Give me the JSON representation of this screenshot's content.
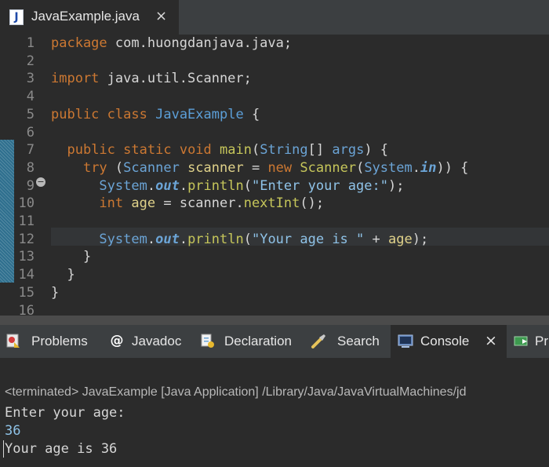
{
  "editor_tab": {
    "label": "JavaExample.java",
    "icon": "java-file-icon",
    "close": "×"
  },
  "code": {
    "line_numbers": [
      "1",
      "2",
      "3",
      "4",
      "5",
      "6",
      "7",
      "8",
      "9",
      "10",
      "11",
      "12",
      "13",
      "14",
      "15",
      "16"
    ],
    "lines": [
      [
        {
          "t": "package",
          "c": "kw"
        },
        {
          "t": " com.huongdanjava.java;",
          "c": "pl"
        }
      ],
      [],
      [
        {
          "t": "import",
          "c": "kw"
        },
        {
          "t": " java.util.Scanner;",
          "c": "pl"
        }
      ],
      [],
      [
        {
          "t": "public",
          "c": "kw"
        },
        {
          "t": " ",
          "c": "pl"
        },
        {
          "t": "class",
          "c": "kw"
        },
        {
          "t": " ",
          "c": "pl"
        },
        {
          "t": "JavaExample",
          "c": "cls"
        },
        {
          "t": " {",
          "c": "pl"
        }
      ],
      [],
      [
        {
          "t": "  ",
          "c": "pl"
        },
        {
          "t": "public",
          "c": "kw"
        },
        {
          "t": " ",
          "c": "pl"
        },
        {
          "t": "static",
          "c": "kw"
        },
        {
          "t": " ",
          "c": "pl"
        },
        {
          "t": "void",
          "c": "kw"
        },
        {
          "t": " ",
          "c": "pl"
        },
        {
          "t": "main",
          "c": "fn"
        },
        {
          "t": "(",
          "c": "pl"
        },
        {
          "t": "String",
          "c": "ty"
        },
        {
          "t": "[] ",
          "c": "pl"
        },
        {
          "t": "args",
          "c": "ty"
        },
        {
          "t": ") {",
          "c": "pl"
        }
      ],
      [
        {
          "t": "    ",
          "c": "pl"
        },
        {
          "t": "try",
          "c": "kw"
        },
        {
          "t": " (",
          "c": "pl"
        },
        {
          "t": "Scanner",
          "c": "ty"
        },
        {
          "t": " ",
          "c": "pl"
        },
        {
          "t": "scanner",
          "c": "var"
        },
        {
          "t": " = ",
          "c": "pl"
        },
        {
          "t": "new",
          "c": "kw"
        },
        {
          "t": " ",
          "c": "pl"
        },
        {
          "t": "Scanner",
          "c": "fn"
        },
        {
          "t": "(",
          "c": "pl"
        },
        {
          "t": "System",
          "c": "ty"
        },
        {
          "t": ".",
          "c": "pl"
        },
        {
          "t": "in",
          "c": "sy"
        },
        {
          "t": ")) {",
          "c": "pl"
        }
      ],
      [
        {
          "t": "      ",
          "c": "pl"
        },
        {
          "t": "System",
          "c": "ty"
        },
        {
          "t": ".",
          "c": "pl"
        },
        {
          "t": "out",
          "c": "sy"
        },
        {
          "t": ".",
          "c": "pl"
        },
        {
          "t": "println",
          "c": "fn"
        },
        {
          "t": "(",
          "c": "pl"
        },
        {
          "t": "\"Enter your age:\"",
          "c": "str"
        },
        {
          "t": ");",
          "c": "pl"
        }
      ],
      [
        {
          "t": "      ",
          "c": "pl"
        },
        {
          "t": "int",
          "c": "kw"
        },
        {
          "t": " ",
          "c": "pl"
        },
        {
          "t": "age",
          "c": "var"
        },
        {
          "t": " = scanner.",
          "c": "pl"
        },
        {
          "t": "nextInt",
          "c": "fn"
        },
        {
          "t": "();",
          "c": "pl"
        }
      ],
      [],
      [
        {
          "t": "      ",
          "c": "pl"
        },
        {
          "t": "System",
          "c": "ty"
        },
        {
          "t": ".",
          "c": "pl"
        },
        {
          "t": "out",
          "c": "sy"
        },
        {
          "t": ".",
          "c": "pl"
        },
        {
          "t": "println",
          "c": "fn"
        },
        {
          "t": "(",
          "c": "pl"
        },
        {
          "t": "\"Your age is \"",
          "c": "str"
        },
        {
          "t": " + ",
          "c": "pl"
        },
        {
          "t": "age",
          "c": "var"
        },
        {
          "t": ");",
          "c": "pl"
        }
      ],
      [
        {
          "t": "    }",
          "c": "pl"
        }
      ],
      [
        {
          "t": "  }",
          "c": "pl"
        }
      ],
      [
        {
          "t": "}",
          "c": "pl"
        }
      ],
      []
    ]
  },
  "view_tabs": [
    {
      "label": "Problems",
      "icon": "problems-icon"
    },
    {
      "label": "Javadoc",
      "icon": "javadoc-icon",
      "glyph": "@"
    },
    {
      "label": "Declaration",
      "icon": "declaration-icon"
    },
    {
      "label": "Search",
      "icon": "search-icon"
    },
    {
      "label": "Console",
      "icon": "console-icon",
      "close": "×"
    },
    {
      "label": "Pr",
      "icon": "progress-icon"
    }
  ],
  "console": {
    "status": "<terminated> JavaExample [Java Application] /Library/Java/JavaVirtualMachines/jd",
    "output": [
      "Enter your age:",
      "36",
      "Your age is 36"
    ]
  },
  "colors": {
    "keyword": "#cc7832",
    "type": "#6ba4d6",
    "method": "#c6c65a",
    "variable": "#e0d28a",
    "string": "#8fc3e8",
    "background": "#2b2b2b"
  }
}
